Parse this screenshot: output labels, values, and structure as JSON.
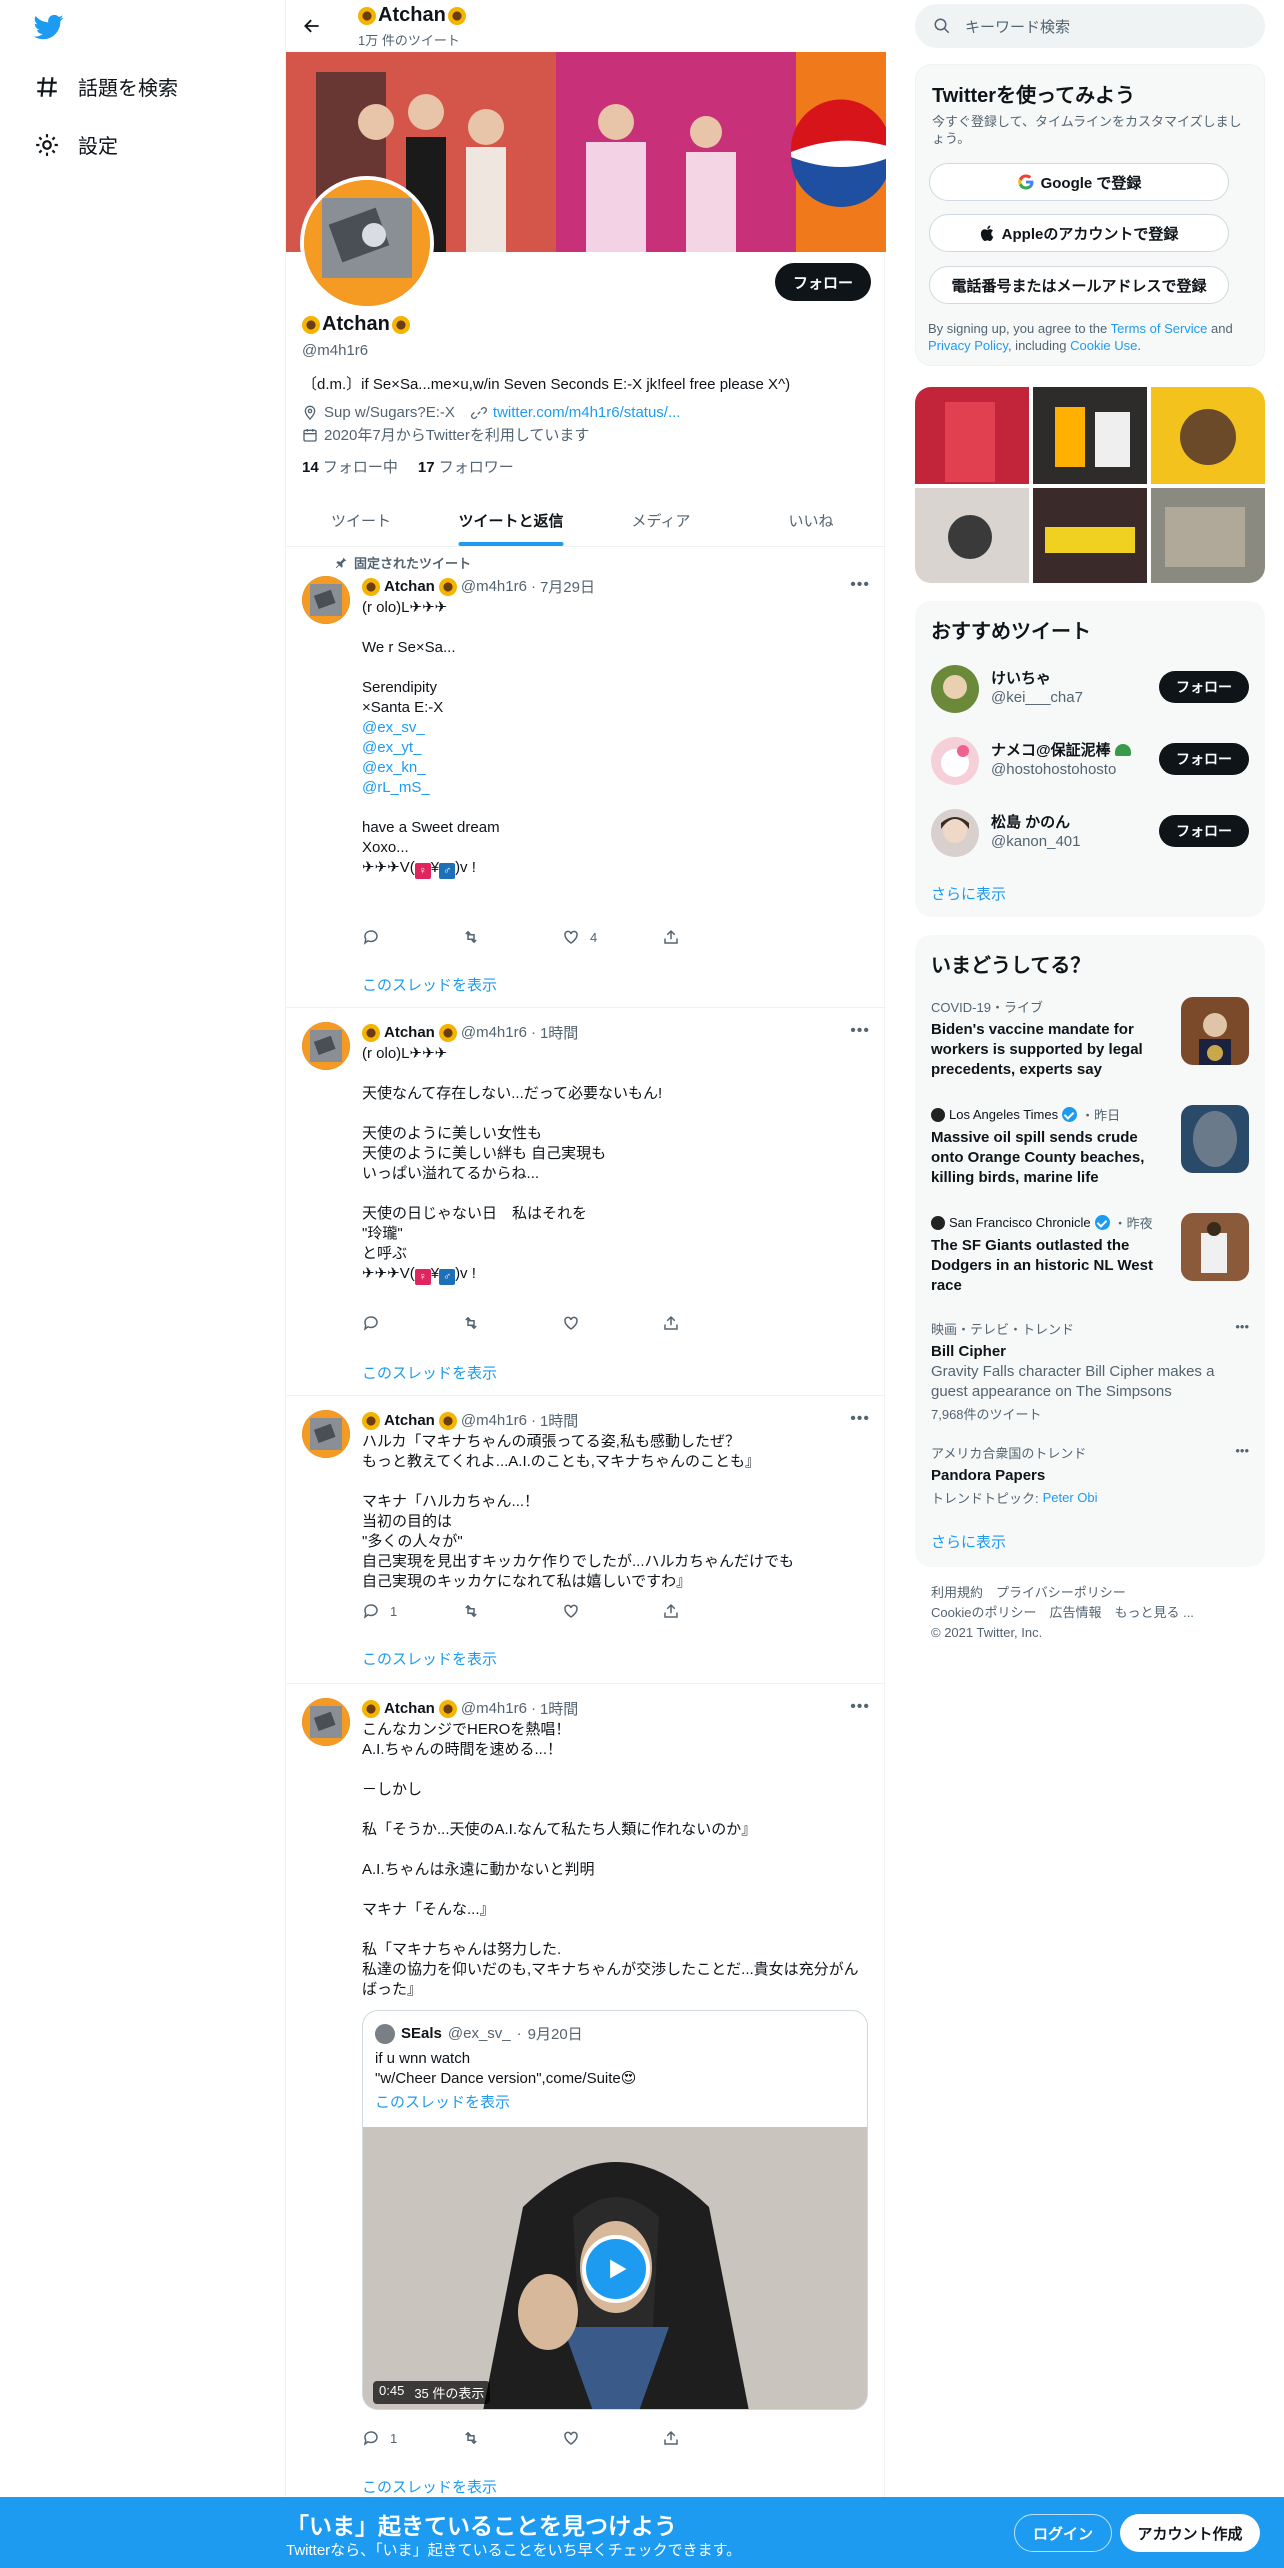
{
  "nav": {
    "explore_label": "話題を検索",
    "settings_label": "設定"
  },
  "header": {
    "name": "Atchan",
    "tweet_count": "1万 件のツイート"
  },
  "profile": {
    "name": "Atchan",
    "handle": "@m4h1r6",
    "follow_label": "フォロー",
    "bio": "〔d.m.〕if Se×Sa...me×u,w/in Seven Seconds E:-X jk!feel free please X^)",
    "location": "Sup w/Sugars?E:-X",
    "url": "twitter.com/m4h1r6/status/...",
    "joined": "2020年7月からTwitterを利用しています",
    "following_count": "14",
    "following_label": "フォロー中",
    "followers_count": "17",
    "followers_label": "フォロワー"
  },
  "tabs": [
    {
      "label": "ツイート"
    },
    {
      "label": "ツイートと返信"
    },
    {
      "label": "メディア"
    },
    {
      "label": "いいね"
    }
  ],
  "pinned_label": "固定されたツイート",
  "thread_label": "このスレッドを表示",
  "tweets": [
    {
      "name": "Atchan",
      "handle": "@m4h1r6",
      "time": "7月29日",
      "text_top": "(r olo)L✈✈✈\n\nWe r Se×Sa...\n\nSerendipity\n×Santa E:-X\n",
      "mentions": [
        "@ex_sv_",
        "@ex_yt_",
        "@ex_kn_",
        "@rL_mS_"
      ],
      "text_bottom": "\nhave a Sweet dream\nXoxo...\n",
      "sign": "✈✈✈V(",
      "sign_end": ")v !",
      "replies": "",
      "retweets": "",
      "likes": "4"
    },
    {
      "name": "Atchan",
      "handle": "@m4h1r6",
      "time": "1時間",
      "text": "(r olo)L✈✈✈\n\n天使なんて存在しない...だって必要ないもん!\n\n天使のように美しい女性も\n天使のように美しい絆も 自己実現も\nいっぱい溢れてるからね...\n\n天使の日じゃない日　私はそれを\n\"玲瓏\"\nと呼ぶ\n",
      "sign": "✈✈✈V(",
      "sign_end": ")v !",
      "replies": "",
      "retweets": "",
      "likes": ""
    },
    {
      "name": "Atchan",
      "handle": "@m4h1r6",
      "time": "1時間",
      "text": "ハルカ「マキナちゃんの頑張ってる姿,私も感動したぜ？\nもっと教えてくれよ...A.I.のことも,マキナちゃんのことも』\n\nマキナ「ハルカちゃん...！\n当初の目的は\n\"多くの人々が\"\n自己実現を見出すキッカケ作りでしたが...ハルカちゃんだけでも\n自己実現のキッカケになれて私は嬉しいですわ』",
      "replies": "1",
      "retweets": "",
      "likes": ""
    },
    {
      "name": "Atchan",
      "handle": "@m4h1r6",
      "time": "1時間",
      "text": "こんなカンジでHEROを熱唱！\nA.I.ちゃんの時間を速める...！\n\n－しかし\n\n私「そうか...天使のA.I.なんて私たち人類に作れないのか』\n\nA.I.ちゃんは永遠に動かないと判明\n\nマキナ「そんな...』\n\n私「マキナちゃんは努力した.\n私達の協力を仰いだのも,マキナちゃんが交渉したことだ...貴女は充分がんばった』",
      "quote": {
        "name": "SEals",
        "handle": "@ex_sv_",
        "time": "9月20日",
        "text": "if u wnn watch\n\"w/Cheer Dance version\",come/Suite😍",
        "thread": "このスレッドを表示",
        "video_time": "0:45",
        "video_views": "35 件の表示"
      },
      "replies": "1",
      "retweets": "",
      "likes": ""
    }
  ],
  "right": {
    "search_placeholder": "キーワード検索",
    "signup_title": "Twitterを使ってみよう",
    "signup_desc": "今すぐ登録して、タイムラインをカスタマイズしましょう。",
    "google_label": "Google で登録",
    "apple_label": "Appleのアカウントで登録",
    "phone_label": "電話番号またはメールアドレスで登録",
    "terms_prefix": "By signing up, you agree to the ",
    "terms_link": "Terms of Service",
    "terms_and": " and ",
    "privacy_link": "Privacy Policy",
    "terms_including": ", including ",
    "cookie_link": "Cookie Use",
    "terms_end": ".",
    "rec_title": "おすすめツイート",
    "rec_users": [
      {
        "name": "けいちゃ",
        "handle": "@kei___cha7",
        "follow": "フォロー"
      },
      {
        "name": "ナメコ@保証泥棒",
        "handle": "@hostohostohosto",
        "follow": "フォロー"
      },
      {
        "name": "松島 かのん",
        "handle": "@kanon_401",
        "follow": "フォロー"
      }
    ],
    "show_more": "さらに表示",
    "trends_title": "いまどうしてる？",
    "trends": [
      {
        "meta": "COVID-19・ライブ",
        "title": "Biden's vaccine mandate for workers is supported by legal precedents, experts say"
      },
      {
        "source": "Los Angeles Times",
        "meta": "・昨日",
        "title": "Massive oil spill sends crude onto Orange County beaches, killing birds, marine life"
      },
      {
        "source": "San Francisco Chronicle",
        "meta": "・昨夜",
        "title": "The SF Giants outlasted the Dodgers in an historic NL West race"
      },
      {
        "meta": "映画・テレビ・トレンド",
        "title": "Bill Cipher",
        "desc": "Gravity Falls character Bill Cipher makes a guest appearance on The Simpsons",
        "count": "7,968件のツイート"
      },
      {
        "meta": "アメリカ合衆国のトレンド",
        "title": "Pandora Papers",
        "topic_prefix": "トレンドトピック: ",
        "topic": "Peter Obi"
      }
    ],
    "footer_line1": "利用規約　プライバシーポリシー",
    "footer_line2": "Cookieのポリシー　広告情報　もっと見る ...",
    "footer_line3": "© 2021 Twitter, Inc."
  },
  "bottom": {
    "title": "「いま」起きていることを見つけよう",
    "subtitle": "Twitterなら、「いま」起きていることをいち早くチェックできます。",
    "login": "ログイン",
    "signup": "アカウント作成"
  },
  "colors": {
    "accent": "#1d9bf0",
    "text": "#0f1419",
    "muted": "#536471",
    "banner": "#f07a1b"
  }
}
